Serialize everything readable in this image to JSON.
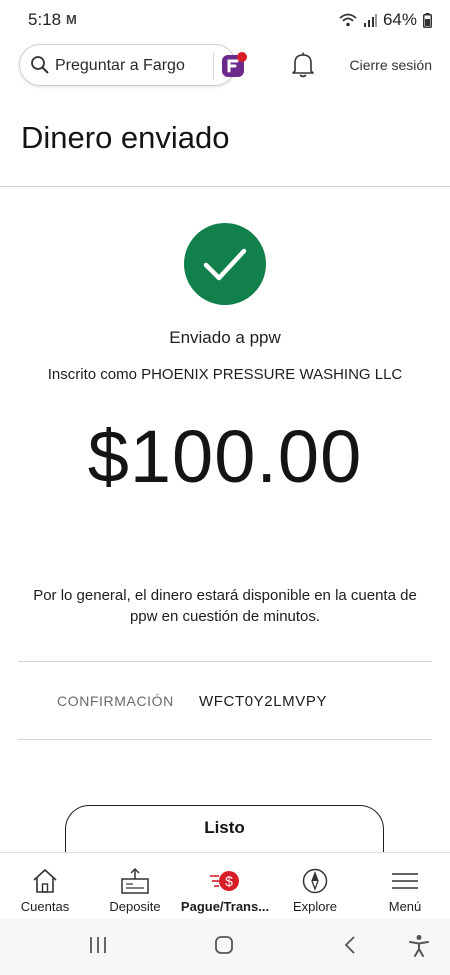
{
  "status_bar": {
    "time": "5:18",
    "mail_glyph": "M",
    "battery": "64%"
  },
  "header": {
    "search_label": "Preguntar a Fargo",
    "logout_label": "Cierre sesión"
  },
  "page": {
    "title": "Dinero enviado",
    "sent_to": "Enviado a ppw",
    "enrolled_as": "Inscrito como PHOENIX PRESSURE WASHING LLC",
    "amount": "$100.00",
    "availability_note": "Por lo general, el dinero estará disponible en la cuenta de ppw en cuestión de minutos.",
    "confirmation_label": "CONFIRMACIÓN",
    "confirmation_value": "WFCT0Y2LMVPY",
    "done_label": "Listo"
  },
  "bottom_nav": [
    {
      "label": "Cuentas",
      "icon": "house-icon"
    },
    {
      "label": "Deposite",
      "icon": "deposit-icon"
    },
    {
      "label": "Pague/Trans...",
      "icon": "pay-transfer-icon"
    },
    {
      "label": "Explore",
      "icon": "compass-icon"
    },
    {
      "label": "Menú",
      "icon": "menu-icon"
    }
  ],
  "colors": {
    "success_green": "#11804a",
    "brand_red": "#d71e28",
    "fargo_purple": "#6c2a8c"
  }
}
